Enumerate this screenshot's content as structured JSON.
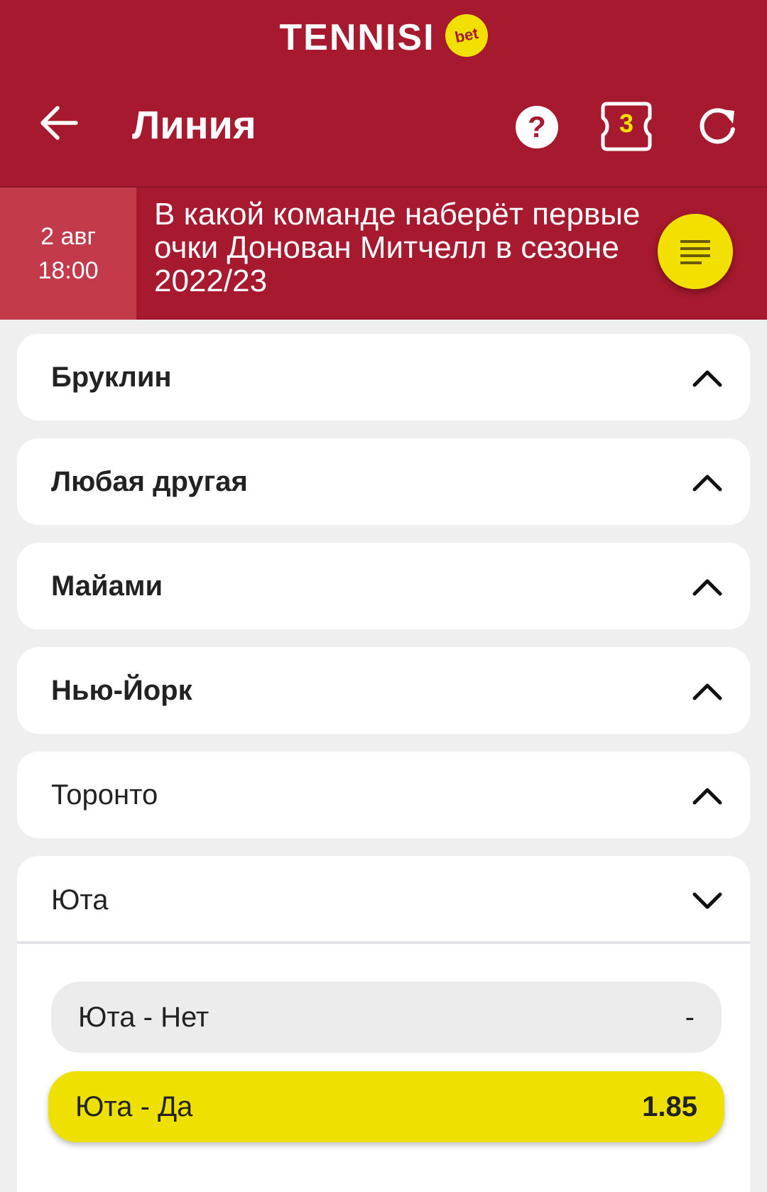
{
  "app": {
    "brand_name": "TENNISI",
    "brand_badge": "bet",
    "accent_color": "#a6192e",
    "highlight_color": "#f2e000"
  },
  "toolbar": {
    "title": "Линия",
    "back_icon": "arrow-left-icon",
    "help_icon": "help-circle-icon",
    "coupon_icon": "coupon-icon",
    "coupon_count": "3",
    "refresh_icon": "refresh-icon"
  },
  "event": {
    "date": "2 авг",
    "time": "18:00",
    "title": "В какой команде наберёт первые\nочки Донован Митчелл в сезоне\n2022/23",
    "filter_icon": "filter-list-icon"
  },
  "markets": [
    {
      "label": "Бруклин",
      "state": "collapsed",
      "chevron": "chevron-up-icon"
    },
    {
      "label": "Любая другая",
      "state": "collapsed",
      "chevron": "chevron-up-icon"
    },
    {
      "label": "Майами",
      "state": "collapsed",
      "chevron": "chevron-up-icon"
    },
    {
      "label": "Нью-Йорк",
      "state": "collapsed",
      "chevron": "chevron-up-icon"
    },
    {
      "label": "Торонто",
      "state": "collapsed",
      "chevron": "chevron-up-icon"
    },
    {
      "label": "Юта",
      "state": "expanded",
      "chevron": "chevron-down-icon",
      "outcomes": [
        {
          "label": "Юта - Нет",
          "odds": "-",
          "state": "disabled"
        },
        {
          "label": "Юта - Да",
          "odds": "1.85",
          "state": "selected"
        }
      ]
    }
  ]
}
